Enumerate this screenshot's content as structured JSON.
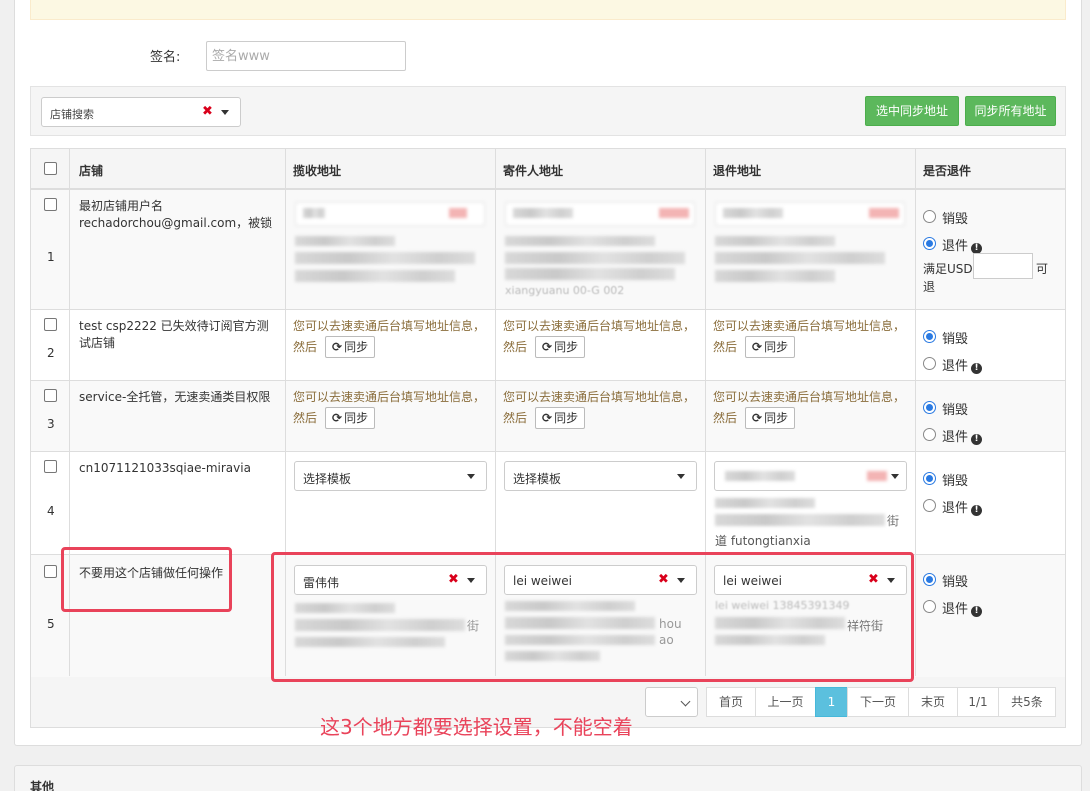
{
  "notice": {},
  "signature": {
    "label": "签名:",
    "placeholder": "签名www"
  },
  "toolbar": {
    "shop_search_label": "店铺搜索",
    "sync_selected_label": "选中同步地址",
    "sync_all_label": "同步所有地址"
  },
  "table": {
    "headers": {
      "shop": "店铺",
      "pickup": "揽收地址",
      "sender": "寄件人地址",
      "return": "退件地址",
      "refund": "是否退件"
    },
    "rows": [
      {
        "num": "1",
        "shop": "最初店铺用户名 rechadorchou@gmail.com，被锁",
        "pickup_partial": "",
        "sender_partial": "xiangyuanu 00-G 002",
        "refund_destroy": "销毁",
        "refund_return": "退件",
        "selected": "return",
        "usd_prefix": "满足USD",
        "usd_suffix": "可退"
      },
      {
        "num": "2",
        "shop": "test csp2222 已失效待订阅官方测试店铺",
        "hint": "您可以去速卖通后台填写地址信息，然后",
        "sync_label": "同步",
        "refund_destroy": "销毁",
        "refund_return": "退件",
        "selected": "destroy"
      },
      {
        "num": "3",
        "shop": "service-全托管，无速卖通类目权限",
        "hint": "您可以去速卖通后台填写地址信息，然后",
        "sync_label": "同步",
        "refund_destroy": "销毁",
        "refund_return": "退件",
        "selected": "destroy"
      },
      {
        "num": "4",
        "shop": "cn1071121033sqiae-miravia",
        "pickup_select": "选择模板",
        "sender_select": "选择模板",
        "return_tail": "道 futongtianxia",
        "return_fragment": "街",
        "refund_destroy": "销毁",
        "refund_return": "退件",
        "selected": "destroy"
      },
      {
        "num": "5",
        "shop": "不要用这个店铺做任何操作",
        "pickup_select": "雷伟伟",
        "sender_select": "lei weiwei",
        "return_select": "lei weiwei",
        "pickup_fragment": "街",
        "sender_fragment_1": "hou",
        "sender_fragment_2": "ao",
        "return_fragment": "祥符街",
        "return_partial": "lei weiwei 13845391349",
        "refund_destroy": "销毁",
        "refund_return": "退件",
        "selected": "destroy"
      }
    ]
  },
  "pagination": {
    "first": "首页",
    "prev": "上一页",
    "current": "1",
    "next": "下一页",
    "last": "末页",
    "pages": "1/1",
    "total": "共5条"
  },
  "annotation": "这3个地方都要选择设置，不能空着",
  "other_section": {
    "title": "其他"
  },
  "colors": {
    "accent_green": "#5cb85c",
    "active_page": "#5bc0de",
    "hint_text": "#8a6d3b",
    "annotation_red": "#e9435a",
    "clear_red": "#d9001b"
  }
}
